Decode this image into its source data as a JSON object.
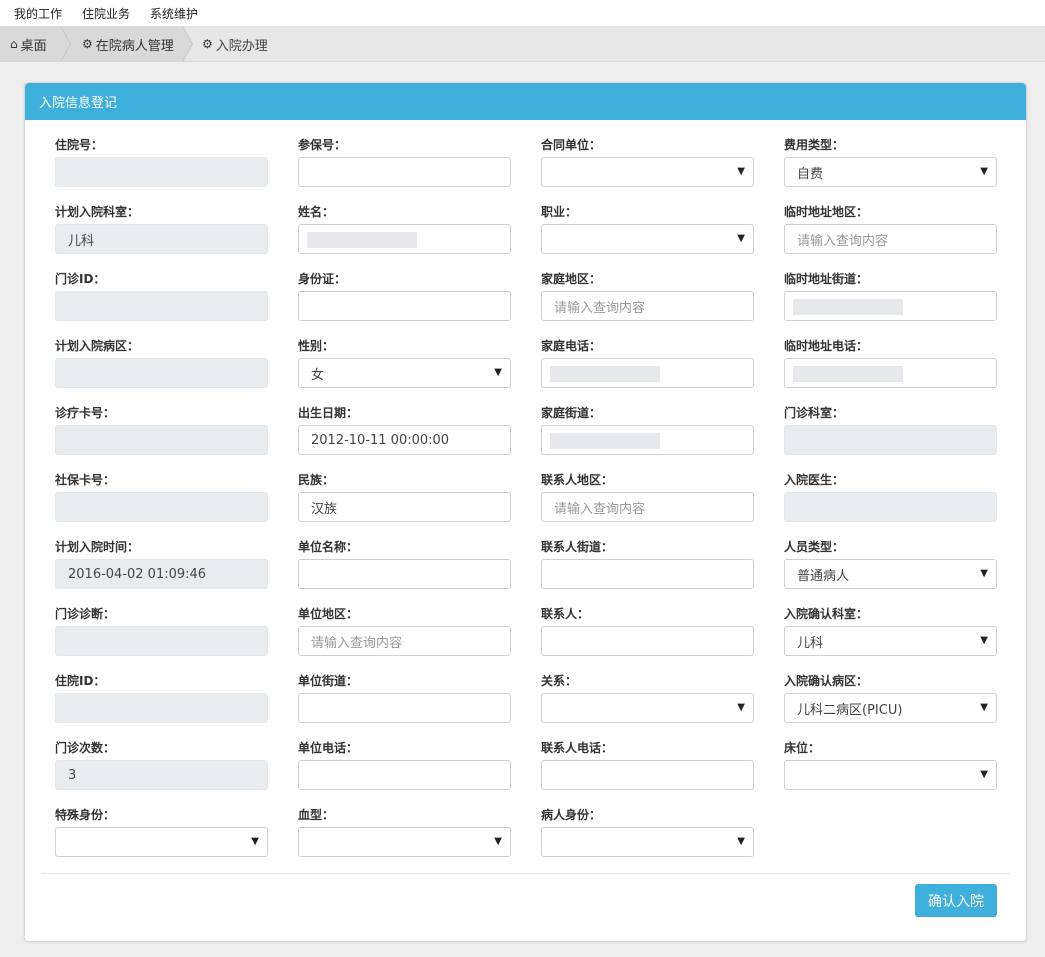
{
  "menu": [
    "我的工作",
    "住院业务",
    "系统维护"
  ],
  "breadcrumb": {
    "home": "桌面",
    "level2": "在院病人管理",
    "current": "入院办理"
  },
  "panel": {
    "title": "入院信息登记"
  },
  "fields": {
    "c0": [
      {
        "label": "住院号：",
        "type": "readonly",
        "value": ""
      },
      {
        "label": "计划入院科室：",
        "type": "readonly",
        "value": "儿科"
      },
      {
        "label": "门诊ID：",
        "type": "readonly",
        "value": ""
      },
      {
        "label": "计划入院病区：",
        "type": "readonly",
        "value": ""
      },
      {
        "label": "诊疗卡号：",
        "type": "readonly",
        "value": ""
      },
      {
        "label": "社保卡号：",
        "type": "readonly",
        "value": ""
      },
      {
        "label": "计划入院时间：",
        "type": "readonly",
        "value": "2016-04-02 01:09:46"
      },
      {
        "label": "门诊诊断：",
        "type": "readonly",
        "value": ""
      },
      {
        "label": "住院ID：",
        "type": "readonly",
        "value": ""
      },
      {
        "label": "门诊次数：",
        "type": "readonly",
        "value": "3"
      },
      {
        "label": "特殊身份：",
        "type": "select",
        "value": ""
      }
    ],
    "c1": [
      {
        "label": "参保号：",
        "type": "input",
        "value": ""
      },
      {
        "label": "姓名：",
        "type": "input",
        "value": "",
        "blur": true
      },
      {
        "label": "身份证：",
        "type": "input",
        "value": ""
      },
      {
        "label": "性别：",
        "type": "select",
        "value": "女"
      },
      {
        "label": "出生日期：",
        "type": "input",
        "value": "2012-10-11 00:00:00"
      },
      {
        "label": "民族：",
        "type": "input",
        "value": "汉族"
      },
      {
        "label": "单位名称：",
        "type": "input",
        "value": ""
      },
      {
        "label": "单位地区：",
        "type": "input",
        "value": "",
        "placeholder": "请输入查询内容"
      },
      {
        "label": "单位街道：",
        "type": "input",
        "value": ""
      },
      {
        "label": "单位电话：",
        "type": "input",
        "value": ""
      },
      {
        "label": "血型：",
        "type": "select",
        "value": ""
      }
    ],
    "c2": [
      {
        "label": "合同单位：",
        "type": "select",
        "value": ""
      },
      {
        "label": "职业：",
        "type": "select",
        "value": ""
      },
      {
        "label": "家庭地区：",
        "type": "input",
        "value": "",
        "placeholder": "请输入查询内容"
      },
      {
        "label": "家庭电话：",
        "type": "input",
        "value": "",
        "blur": true
      },
      {
        "label": "家庭街道：",
        "type": "input",
        "value": "",
        "blur": true
      },
      {
        "label": "联系人地区：",
        "type": "input",
        "value": "",
        "placeholder": "请输入查询内容"
      },
      {
        "label": "联系人街道：",
        "type": "input",
        "value": ""
      },
      {
        "label": "联系人：",
        "type": "input",
        "value": ""
      },
      {
        "label": "关系：",
        "type": "select",
        "value": ""
      },
      {
        "label": "联系人电话：",
        "type": "input",
        "value": ""
      },
      {
        "label": "病人身份：",
        "type": "select",
        "value": ""
      }
    ],
    "c3": [
      {
        "label": "费用类型：",
        "type": "select",
        "value": "自费"
      },
      {
        "label": "临时地址地区：",
        "type": "input",
        "value": "",
        "placeholder": "请输入查询内容"
      },
      {
        "label": "临时地址街道：",
        "type": "input",
        "value": "",
        "blur": true
      },
      {
        "label": "临时地址电话：",
        "type": "input",
        "value": "",
        "blur": true
      },
      {
        "label": "门诊科室：",
        "type": "readonly",
        "value": ""
      },
      {
        "label": "入院医生：",
        "type": "readonly",
        "value": ""
      },
      {
        "label": "人员类型：",
        "type": "select",
        "value": "普通病人"
      },
      {
        "label": "入院确认科室：",
        "type": "select",
        "value": "儿科"
      },
      {
        "label": "入院确认病区：",
        "type": "select",
        "value": "儿科二病区(PICU)"
      },
      {
        "label": "床位：",
        "type": "select",
        "value": ""
      }
    ]
  },
  "confirm_button": "确认入院",
  "colors": {
    "accent": "#3fb0dc",
    "readonly_bg": "#e9ecef"
  }
}
